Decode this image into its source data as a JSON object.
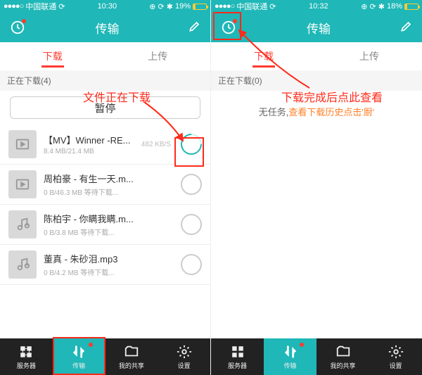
{
  "left": {
    "status": {
      "carrier": "中国联通",
      "time": "10:30",
      "battery": "19%"
    },
    "title": "传输",
    "tabs": {
      "download": "下载",
      "upload": "上传"
    },
    "section": "正在下载(4)",
    "pause": "暂停",
    "items": [
      {
        "name": "【MV】Winner -RE...",
        "sub": "8.4 MB/21.4 MB",
        "speed": "482 KB/S",
        "type": "video",
        "active": true
      },
      {
        "name": "周柏豪 - 有生一天.m...",
        "sub": "0 B/46.3 MB 等待下载...",
        "speed": "",
        "type": "video",
        "active": false
      },
      {
        "name": "陈柏宇 - 你瞒我瞒.m...",
        "sub": "0 B/3.8 MB 等待下载...",
        "speed": "",
        "type": "music",
        "active": false
      },
      {
        "name": "董真 - 朱砂泪.mp3",
        "sub": "0 B/4.2 MB 等待下载...",
        "speed": "",
        "type": "music",
        "active": false
      }
    ]
  },
  "right": {
    "status": {
      "carrier": "中国联通",
      "time": "10:32",
      "battery": "18%"
    },
    "title": "传输",
    "tabs": {
      "download": "下载",
      "upload": "上传"
    },
    "section": "正在下载(0)",
    "empty_pre": "无任务,",
    "empty_hl": "查看下载历史点击'㕑'"
  },
  "bottom": {
    "server": "服务器",
    "transfer": "传输",
    "share": "我的共享",
    "settings": "设置"
  },
  "annotations": {
    "left_label": "文件正在下载",
    "right_label": "下载完成后点此查看"
  }
}
